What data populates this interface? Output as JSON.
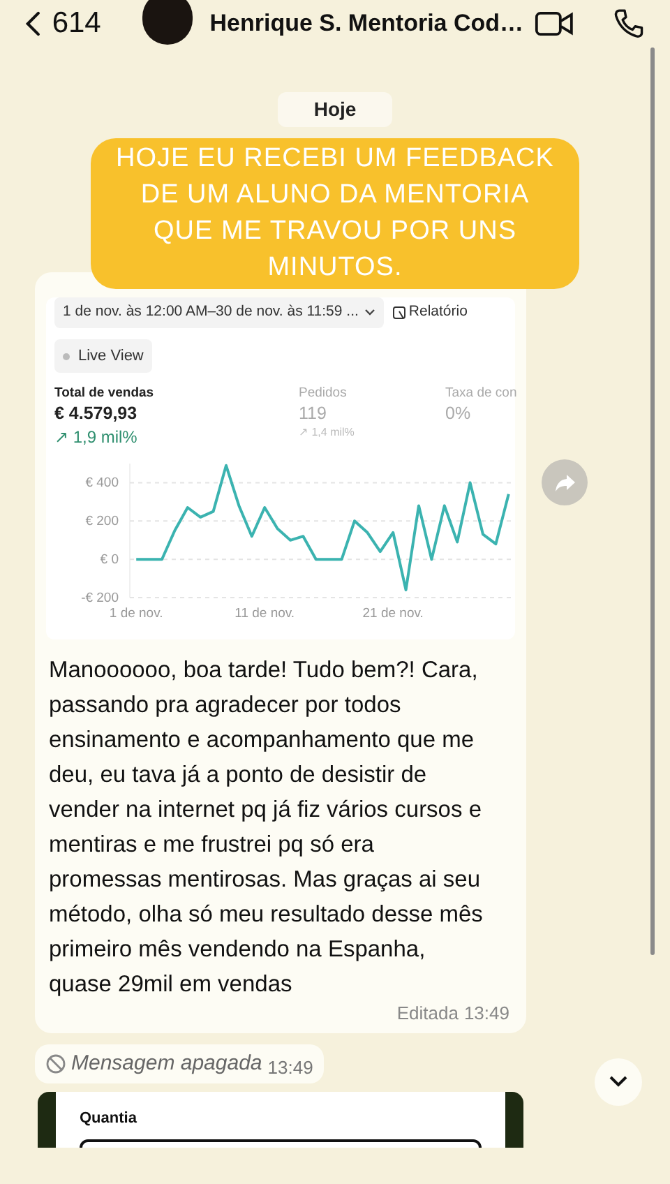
{
  "header": {
    "back_count": "614",
    "title": "Henrique S. Mentoria Cod…"
  },
  "date_chip": "Hoje",
  "caption": "HOJE EU RECEBI UM FEEDBACK DE UM ALUNO DA MENTORIA QUE ME TRAVOU POR UNS MINUTOS.",
  "shared_screenshot": {
    "date_range": "1 de nov. às 12:00 AM–30 de nov. às 11:59 ...",
    "report_button": "Relatório",
    "live_view": "Live View",
    "metrics": [
      {
        "label": "Total de vendas",
        "value": "€ 4.579,93",
        "change": "↗ 1,9 mil%",
        "selected": true
      },
      {
        "label": "Pedidos",
        "value": "119",
        "change": "↗ 1,4 mil%",
        "selected": false
      },
      {
        "label": "Taxa de con",
        "value": "0%",
        "selected": false
      }
    ],
    "chart_data": {
      "type": "line",
      "categories": [
        "1 de nov.",
        null,
        null,
        null,
        null,
        null,
        null,
        null,
        null,
        null,
        "11 de nov.",
        null,
        null,
        null,
        null,
        null,
        null,
        null,
        null,
        null,
        "21 de nov.",
        null,
        null,
        null,
        null,
        null,
        null,
        null,
        null,
        null
      ],
      "ylim": [
        -200,
        500
      ],
      "grid": true,
      "yticks": [
        {
          "value": -200,
          "label": "-€ 200"
        },
        {
          "value": 0,
          "label": "€ 0"
        },
        {
          "value": 200,
          "label": "€ 200"
        },
        {
          "value": 400,
          "label": "€ 400"
        }
      ],
      "series": [
        {
          "color": "#3bb3b0",
          "values": [
            0,
            0,
            0,
            150,
            270,
            220,
            250,
            490,
            280,
            120,
            270,
            160,
            100,
            120,
            0,
            0,
            0,
            200,
            140,
            40,
            140,
            -160,
            280,
            0,
            280,
            90,
            400,
            130,
            80,
            340
          ]
        }
      ]
    }
  },
  "message": {
    "text": "Manoooooo, boa tarde! Tudo bem?! Cara, passando pra agradecer por todos ensinamento e acompanhamento que me deu, eu tava já a ponto de desistir de vender na internet pq já fiz vários cursos e mentiras e me frustrei pq só era promessas mentirosas. Mas graças ai seu método, olha só meu resultado desse mês primeiro mês vendendo na Espanha, quase 29mil em vendas",
    "edited": "Editada",
    "time": "13:49"
  },
  "deleted_message": {
    "text": "Mensagem apagada",
    "time": "13:49"
  },
  "bottom_card": {
    "label": "Quantia"
  }
}
